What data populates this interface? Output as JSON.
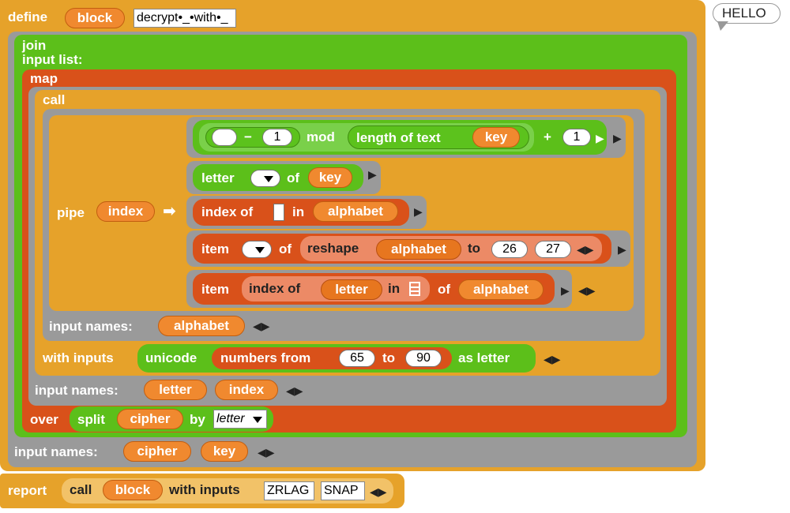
{
  "define": {
    "label": "define",
    "block_name": "block",
    "spec": "decrypt•_•with•_"
  },
  "bubble": {
    "text": "HELLO"
  },
  "join": {
    "label": "join",
    "input_list": "input list:"
  },
  "map": {
    "label": "map",
    "over": "over"
  },
  "call": {
    "label": "call"
  },
  "pipe": {
    "label": "pipe",
    "var": "index",
    "arrow": "➡"
  },
  "row1": {
    "minus": "−",
    "one": "1",
    "mod": "mod",
    "length_of_text": "length of text",
    "key": "key",
    "plus": "+",
    "one2": "1"
  },
  "row2": {
    "letter": "letter",
    "of": "of",
    "key": "key"
  },
  "row3": {
    "index_of": "index of",
    "in": "in",
    "alphabet": "alphabet"
  },
  "row4": {
    "item": "item",
    "of": "of",
    "reshape": "reshape",
    "alphabet": "alphabet",
    "to": "to",
    "n1": "26",
    "n2": "27"
  },
  "row5": {
    "item": "item",
    "index_of": "index of",
    "letter": "letter",
    "in": "in",
    "of": "of",
    "alphabet": "alphabet"
  },
  "inner_input_names": {
    "label": "input names:",
    "alphabet": "alphabet"
  },
  "with_inputs": {
    "label": "with inputs",
    "unicode": "unicode",
    "numbers_from": "numbers from",
    "from": "65",
    "to": "to",
    "to_val": "90",
    "as_letter": "as letter"
  },
  "map_input_names": {
    "label": "input names:",
    "letter": "letter",
    "index": "index"
  },
  "split": {
    "label": "split",
    "cipher": "cipher",
    "by": "by",
    "by_value": "letter"
  },
  "outer_input_names": {
    "label": "input names:",
    "cipher": "cipher",
    "key": "key"
  },
  "report": {
    "label": "report",
    "call": "call",
    "block": "block",
    "with_inputs": "with inputs",
    "arg1": "ZRLAG",
    "arg2": "SNAP"
  },
  "arrows": {
    "right": "▶",
    "lr": "◀▶"
  }
}
